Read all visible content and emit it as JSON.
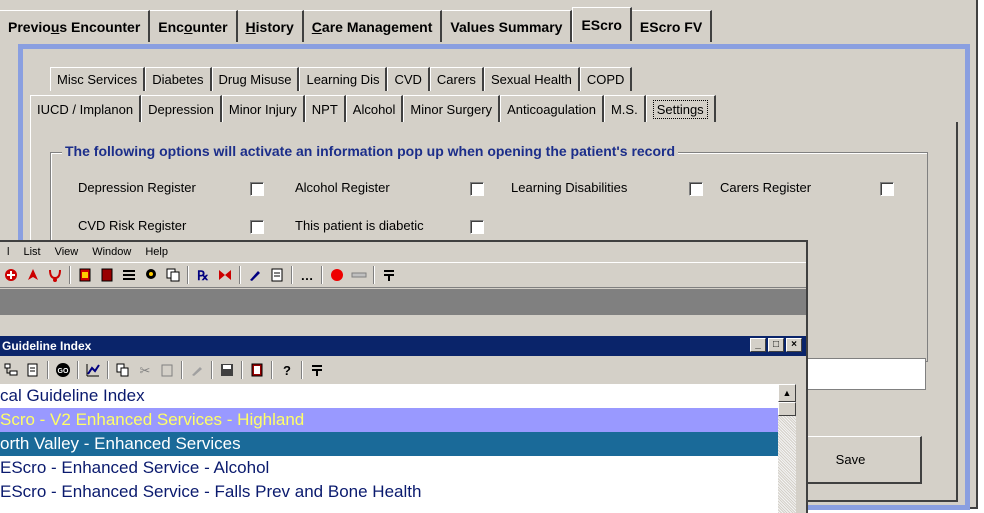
{
  "main_tabs": [
    {
      "label_a": "Previo",
      "ul": "u",
      "label_b": "s Encounter"
    },
    {
      "label_a": "Enc",
      "ul": "o",
      "label_b": "unter"
    },
    {
      "label_a": "",
      "ul": "H",
      "label_b": "istory"
    },
    {
      "label_a": "",
      "ul": "C",
      "label_b": "are Management"
    },
    {
      "label_a": "Values Summary",
      "ul": "",
      "label_b": ""
    },
    {
      "label_a": "EScro",
      "ul": "",
      "label_b": ""
    },
    {
      "label_a": "EScro FV",
      "ul": "",
      "label_b": ""
    }
  ],
  "subtabs_row1": [
    "Misc Services",
    "Diabetes",
    "Drug Misuse",
    "Learning Dis",
    "CVD",
    "Carers",
    "Sexual Health",
    "COPD"
  ],
  "subtabs_row2": [
    "IUCD / Implanon",
    "Depression",
    "Minor Injury",
    "NPT",
    "Alcohol",
    "Minor Surgery",
    "Anticoagulation",
    "M.S.",
    "Settings"
  ],
  "settings": {
    "group_title": "The following options will activate an information pop up when opening the patient's record",
    "options": [
      "Depression Register",
      "Alcohol Register",
      "Learning Disabilities",
      "Carers Register",
      "CVD Risk Register",
      "This patient is diabetic"
    ],
    "save_label": "Save"
  },
  "app": {
    "menu": [
      "l",
      "List",
      "View",
      "Window",
      "Help"
    ]
  },
  "guideline_window": {
    "title": "Guideline Index",
    "controls": [
      "_",
      "□",
      "×"
    ],
    "rows": [
      "cal Guideline Index",
      "Scro - V2 Enhanced Services  - Highland",
      "orth Valley - Enhanced Services",
      " EScro - Enhanced Service - Alcohol",
      " EScro - Enhanced Service - Falls Prev and Bone Health"
    ]
  },
  "icons": {
    "toolbar": [
      "plus-icon",
      "pointer-icon",
      "stethoscope-icon",
      "record-icon",
      "book-icon",
      "list-icon",
      "chat-icon",
      "copy-icon",
      "rx-icon",
      "bowtie-icon",
      "pen-icon",
      "notes-icon",
      "more-icon",
      "red-dot-icon",
      "bar-icon",
      "pin-icon"
    ],
    "gw_toolbar": [
      "tree-icon",
      "open-icon",
      "go-icon",
      "chart-icon",
      "copy-icon",
      "cut-icon",
      "paste-icon",
      "brush-icon",
      "save-icon",
      "book-icon",
      "help-icon",
      "pin-icon"
    ]
  },
  "colors": {
    "group_title": "#1c2e8a",
    "frame_blue": "#8a9fe0",
    "titlebar": "#0a246a",
    "row_purple": "#9999ff",
    "row_purple_text": "#ffff66",
    "row_blue": "#1a6a99"
  }
}
